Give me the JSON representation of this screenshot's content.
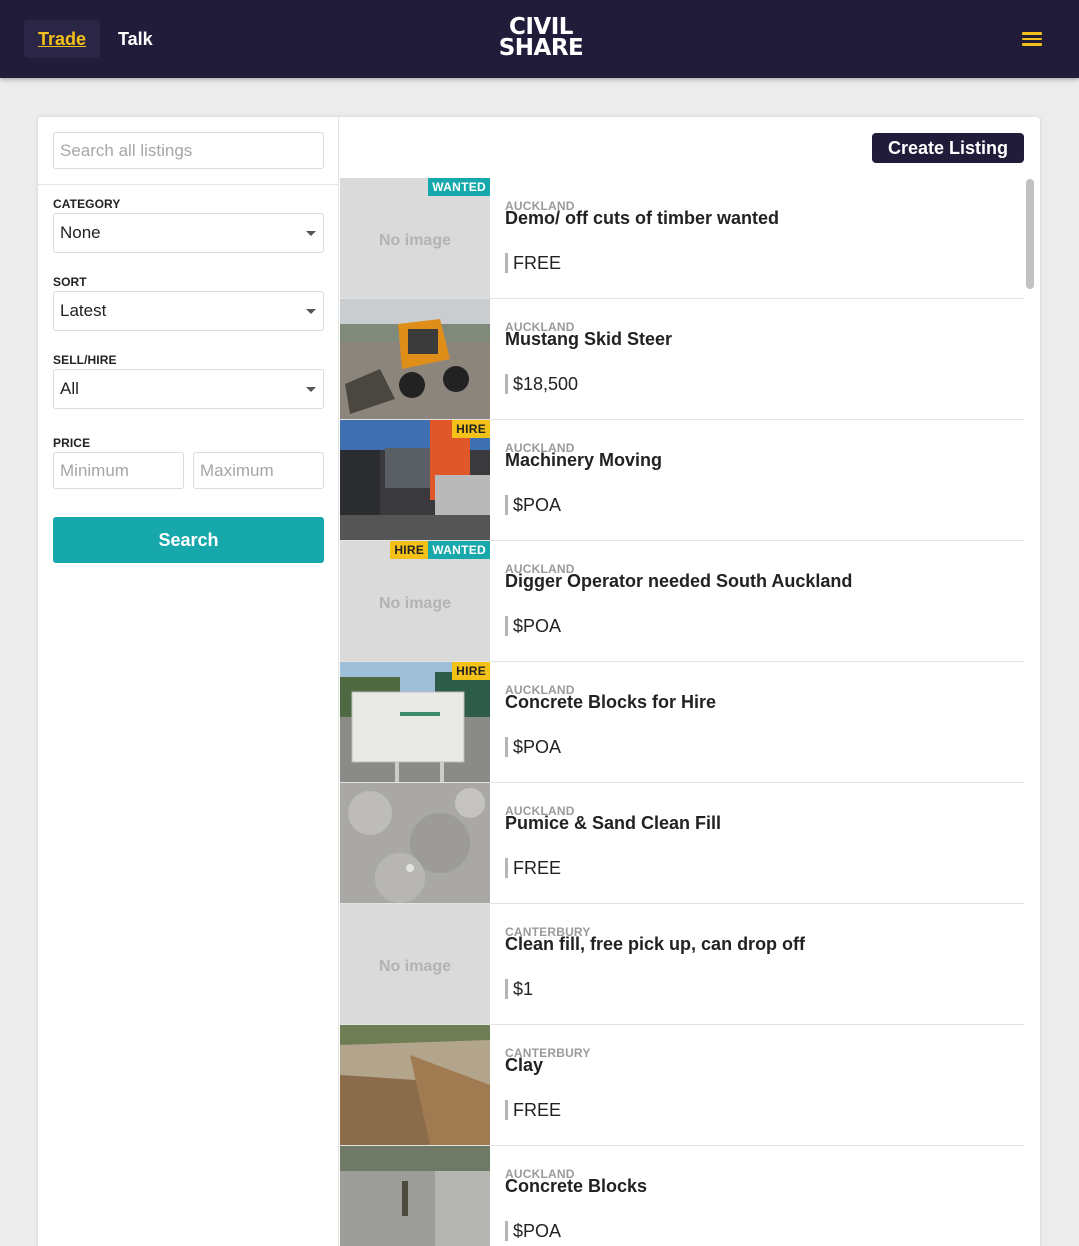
{
  "nav": {
    "trade_label": "Trade",
    "talk_label": "Talk",
    "logo_line1": "CIVIL",
    "logo_line2": "SHARE",
    "menu_icon": "hamburger-menu-icon"
  },
  "filters": {
    "search_placeholder": "Search all listings",
    "category_label": "CATEGORY",
    "category_value": "None",
    "sort_label": "SORT",
    "sort_value": "Latest",
    "sellhire_label": "SELL/HIRE",
    "sellhire_value": "All",
    "price_label": "PRICE",
    "min_placeholder": "Minimum",
    "max_placeholder": "Maximum",
    "search_button": "Search"
  },
  "actions": {
    "create_listing": "Create Listing"
  },
  "colors": {
    "navy": "#221c3b",
    "accent_yellow": "#f4c118",
    "teal": "#17a8ac"
  },
  "listings": [
    {
      "location": "AUCKLAND",
      "title": "Demo/ off cuts of timber wanted",
      "price": "FREE",
      "image": "No image",
      "badges": [
        "WANTED"
      ]
    },
    {
      "location": "AUCKLAND",
      "title": "Mustang Skid Steer",
      "price": "$18,500",
      "image": "photo-skid-steer",
      "badges": []
    },
    {
      "location": "AUCKLAND",
      "title": "Machinery Moving",
      "price": "$POA",
      "image": "photo-truck",
      "badges": [
        "HIRE"
      ]
    },
    {
      "location": "AUCKLAND",
      "title": "Digger Operator needed South Auckland",
      "price": "$POA",
      "image": "No image",
      "badges": [
        "HIRE",
        "WANTED"
      ]
    },
    {
      "location": "AUCKLAND",
      "title": "Concrete Blocks for Hire",
      "price": "$POA",
      "image": "photo-blocks",
      "badges": [
        "HIRE"
      ]
    },
    {
      "location": "AUCKLAND",
      "title": "Pumice & Sand Clean Fill",
      "price": "FREE",
      "image": "photo-fill",
      "badges": []
    },
    {
      "location": "CANTERBURY",
      "title": "Clean fill, free pick up, can drop off",
      "price": "$1",
      "image": "No image",
      "badges": []
    },
    {
      "location": "CANTERBURY",
      "title": "Clay",
      "price": "FREE",
      "image": "photo-clay",
      "badges": []
    },
    {
      "location": "AUCKLAND",
      "title": "Concrete Blocks",
      "price": "$POA",
      "image": "photo-wall",
      "badges": []
    }
  ]
}
